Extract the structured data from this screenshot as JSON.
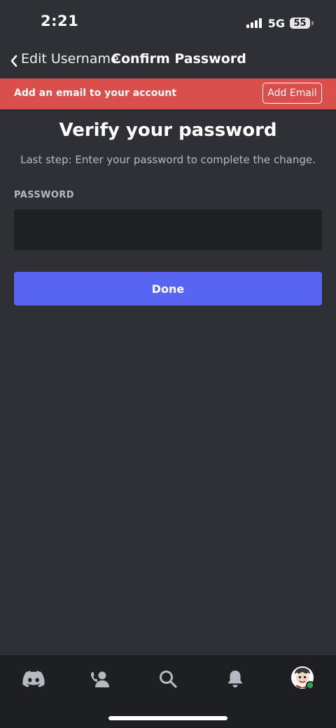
{
  "status_bar": {
    "time": "2:21",
    "network": "5G",
    "battery": "55"
  },
  "nav": {
    "back_label": "Edit Username",
    "title": "Confirm Password"
  },
  "banner": {
    "text": "Add an email to your account",
    "button_label": "Add Email",
    "background_color": "#da4f4b"
  },
  "main": {
    "heading": "Verify your password",
    "subheading": "Last step: Enter your password to complete the change.",
    "password_label": "PASSWORD",
    "password_value": "",
    "done_label": "Done",
    "accent_color": "#5865f2"
  },
  "tab_bar": {
    "tabs": [
      {
        "icon": "discord-home-icon",
        "active": true
      },
      {
        "icon": "friends-icon",
        "active": false
      },
      {
        "icon": "search-icon",
        "active": false
      },
      {
        "icon": "notifications-bell-icon",
        "active": false
      },
      {
        "icon": "user-avatar",
        "active": false,
        "status": "online"
      }
    ]
  }
}
